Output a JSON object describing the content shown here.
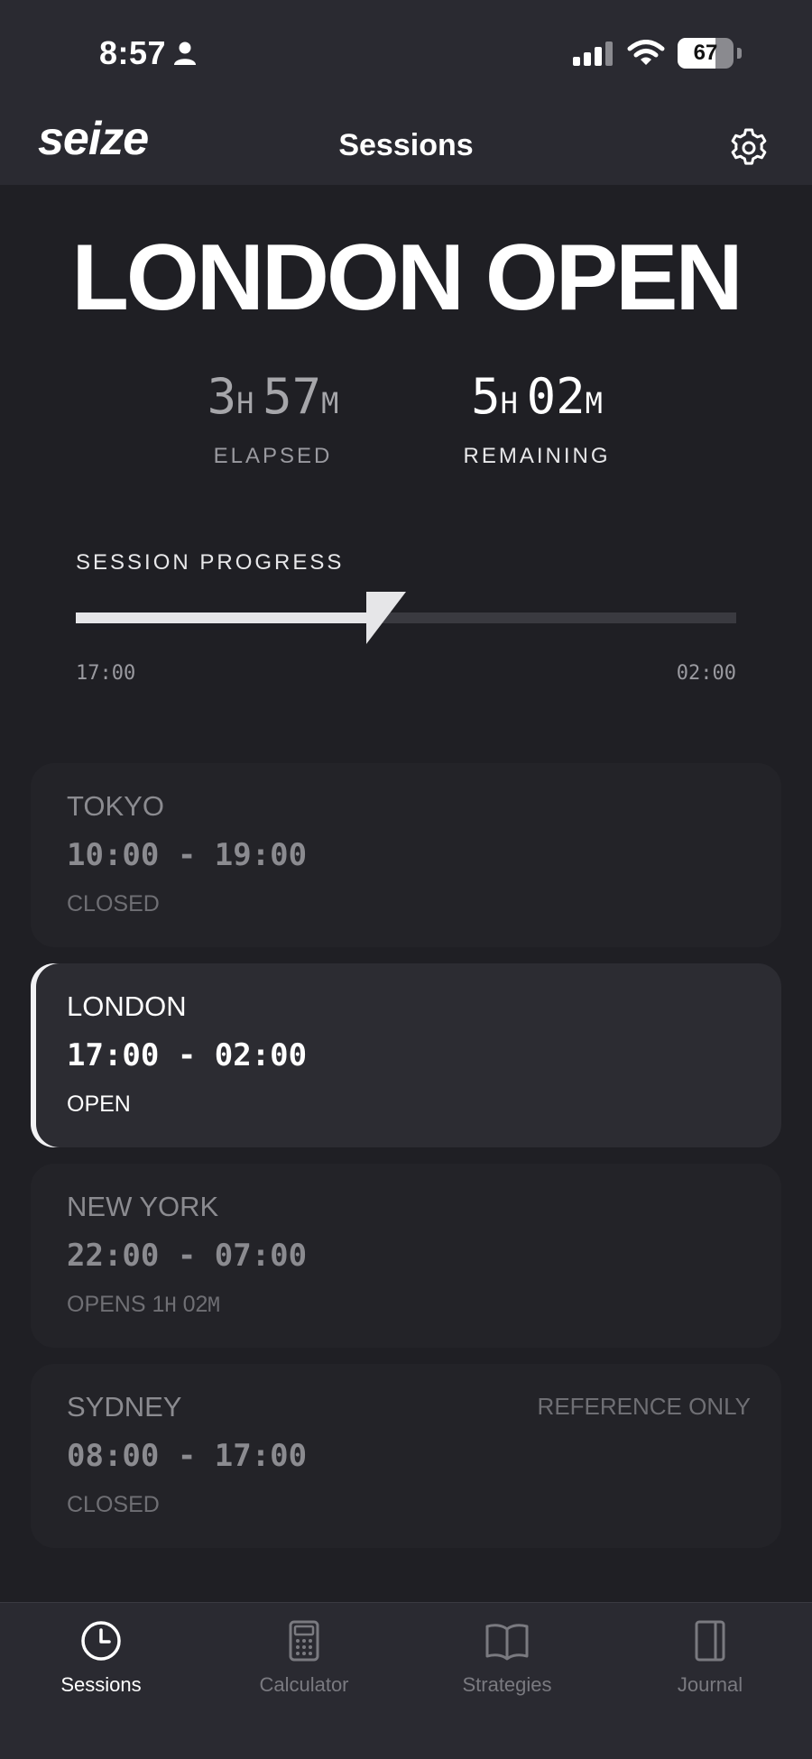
{
  "status_bar": {
    "time": "8:57",
    "battery": "67",
    "battery_fraction": 0.67,
    "icons": [
      "person-icon",
      "cellular-signal-icon",
      "wifi-icon",
      "battery-icon"
    ]
  },
  "header": {
    "brand": "seize",
    "title": "Sessions",
    "settings_icon": "gear-icon"
  },
  "hero": {
    "title": "LONDON OPEN",
    "elapsed": {
      "h": "3",
      "h_unit": "H",
      "m": "57",
      "m_unit": "M",
      "label": "ELAPSED"
    },
    "remaining": {
      "h": "5",
      "h_unit": "H",
      "m": "02",
      "m_unit": "M",
      "label": "REMAINING"
    }
  },
  "progress": {
    "label": "SESSION PROGRESS",
    "start": "17:00",
    "end": "02:00",
    "fraction": 0.44
  },
  "sessions": [
    {
      "name": "TOKYO",
      "hours": "10:00 - 19:00",
      "status": "CLOSED",
      "active": false
    },
    {
      "name": "LONDON",
      "hours": "17:00 - 02:00",
      "status": "OPEN",
      "active": true
    },
    {
      "name": "NEW YORK",
      "hours": "22:00 - 07:00",
      "status_prefix": "OPENS 1",
      "status_unit_h": "H",
      "status_mid": " 02",
      "status_unit_m": "M",
      "active": false
    },
    {
      "name": "SYDNEY",
      "hours": "08:00 - 17:00",
      "status": "CLOSED",
      "note": "REFERENCE ONLY",
      "active": false
    }
  ],
  "tabs": [
    {
      "label": "Sessions",
      "icon": "clock-icon",
      "active": true
    },
    {
      "label": "Calculator",
      "icon": "calculator-icon",
      "active": false
    },
    {
      "label": "Strategies",
      "icon": "book-icon",
      "active": false
    },
    {
      "label": "Journal",
      "icon": "journal-icon",
      "active": false
    }
  ],
  "colors": {
    "background": "#1f1f24",
    "chrome": "#2a2a31",
    "active_card": "#2c2c32",
    "accent": "#f2f2f4"
  }
}
